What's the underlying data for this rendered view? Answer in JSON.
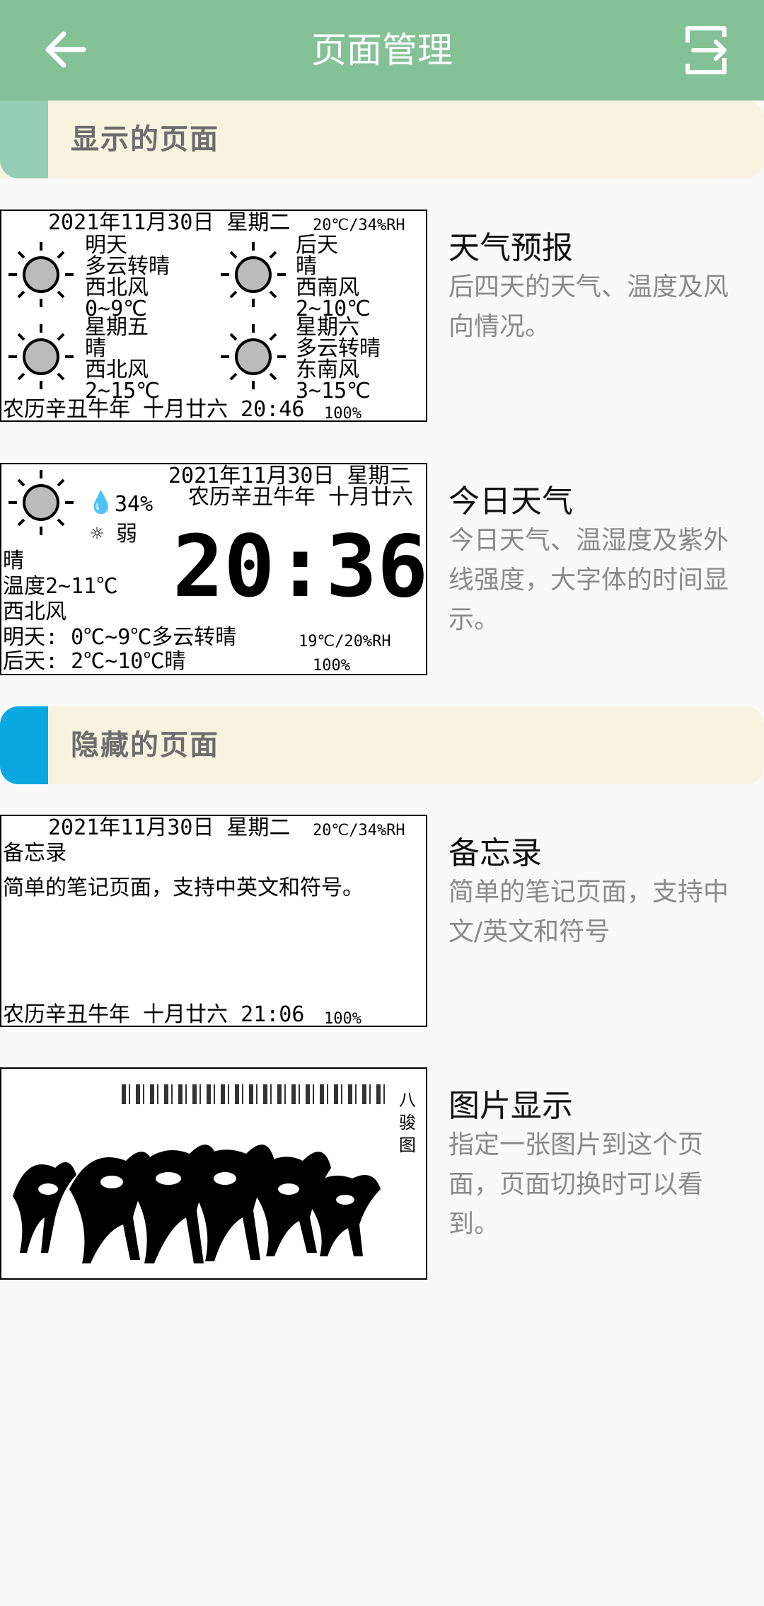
{
  "appbar": {
    "title": "页面管理",
    "back_icon": "arrow-left-icon",
    "action_icon": "export-icon"
  },
  "sections": {
    "shown": {
      "label": "显示的页面",
      "accent": "#93cdb6"
    },
    "hidden": {
      "label": "隐藏的页面",
      "accent": "#0aa8e0"
    }
  },
  "items": [
    {
      "title": "天气预报",
      "desc": "后四天的天气、温度及风向情况。",
      "preview": {
        "header": "2021年11月30日 星期二",
        "env": "20℃/34%RH",
        "days": [
          {
            "day": "明天",
            "weather": "多云转晴",
            "wind": "西北风",
            "temp": "0~9℃"
          },
          {
            "day": "后天",
            "weather": "晴",
            "wind": "西南风",
            "temp": "2~10℃"
          },
          {
            "day": "星期五",
            "weather": "晴",
            "wind": "西北风",
            "temp": "2~15℃"
          },
          {
            "day": "星期六",
            "weather": "多云转晴",
            "wind": "东南风",
            "temp": "3~15℃"
          }
        ],
        "footer": "农历辛丑牛年 十月廿六 20:46",
        "battery": "100%"
      }
    },
    {
      "title": "今日天气",
      "desc": "今日天气、温湿度及紫外线强度，大字体的时间显示。",
      "preview": {
        "date": "2021年11月30日 星期二",
        "lunar": "农历辛丑牛年 十月廿六",
        "humidity": "34%",
        "uv": "弱",
        "weather": "晴",
        "temp": "温度2~11℃",
        "wind": "西北风",
        "tomorrow": "明天: 0℃~9℃多云转晴",
        "after": "后天: 2℃~10℃晴",
        "time": "20:36",
        "env": "19℃/20%RH",
        "battery": "100%"
      }
    },
    {
      "title": "备忘录",
      "desc": "简单的笔记页面，支持中文/英文和符号",
      "preview": {
        "header": "2021年11月30日 星期二",
        "env": "20℃/34%RH",
        "note_title": "备忘录",
        "note_body": "简单的笔记页面，支持中英文和符号。",
        "footer": "农历辛丑牛年 十月廿六 21:06",
        "battery": "100%"
      }
    },
    {
      "title": "图片显示",
      "desc": "指定一张图片到这个页面，页面切换时可以看到。",
      "preview": {
        "side_text": "八骏图"
      }
    }
  ]
}
